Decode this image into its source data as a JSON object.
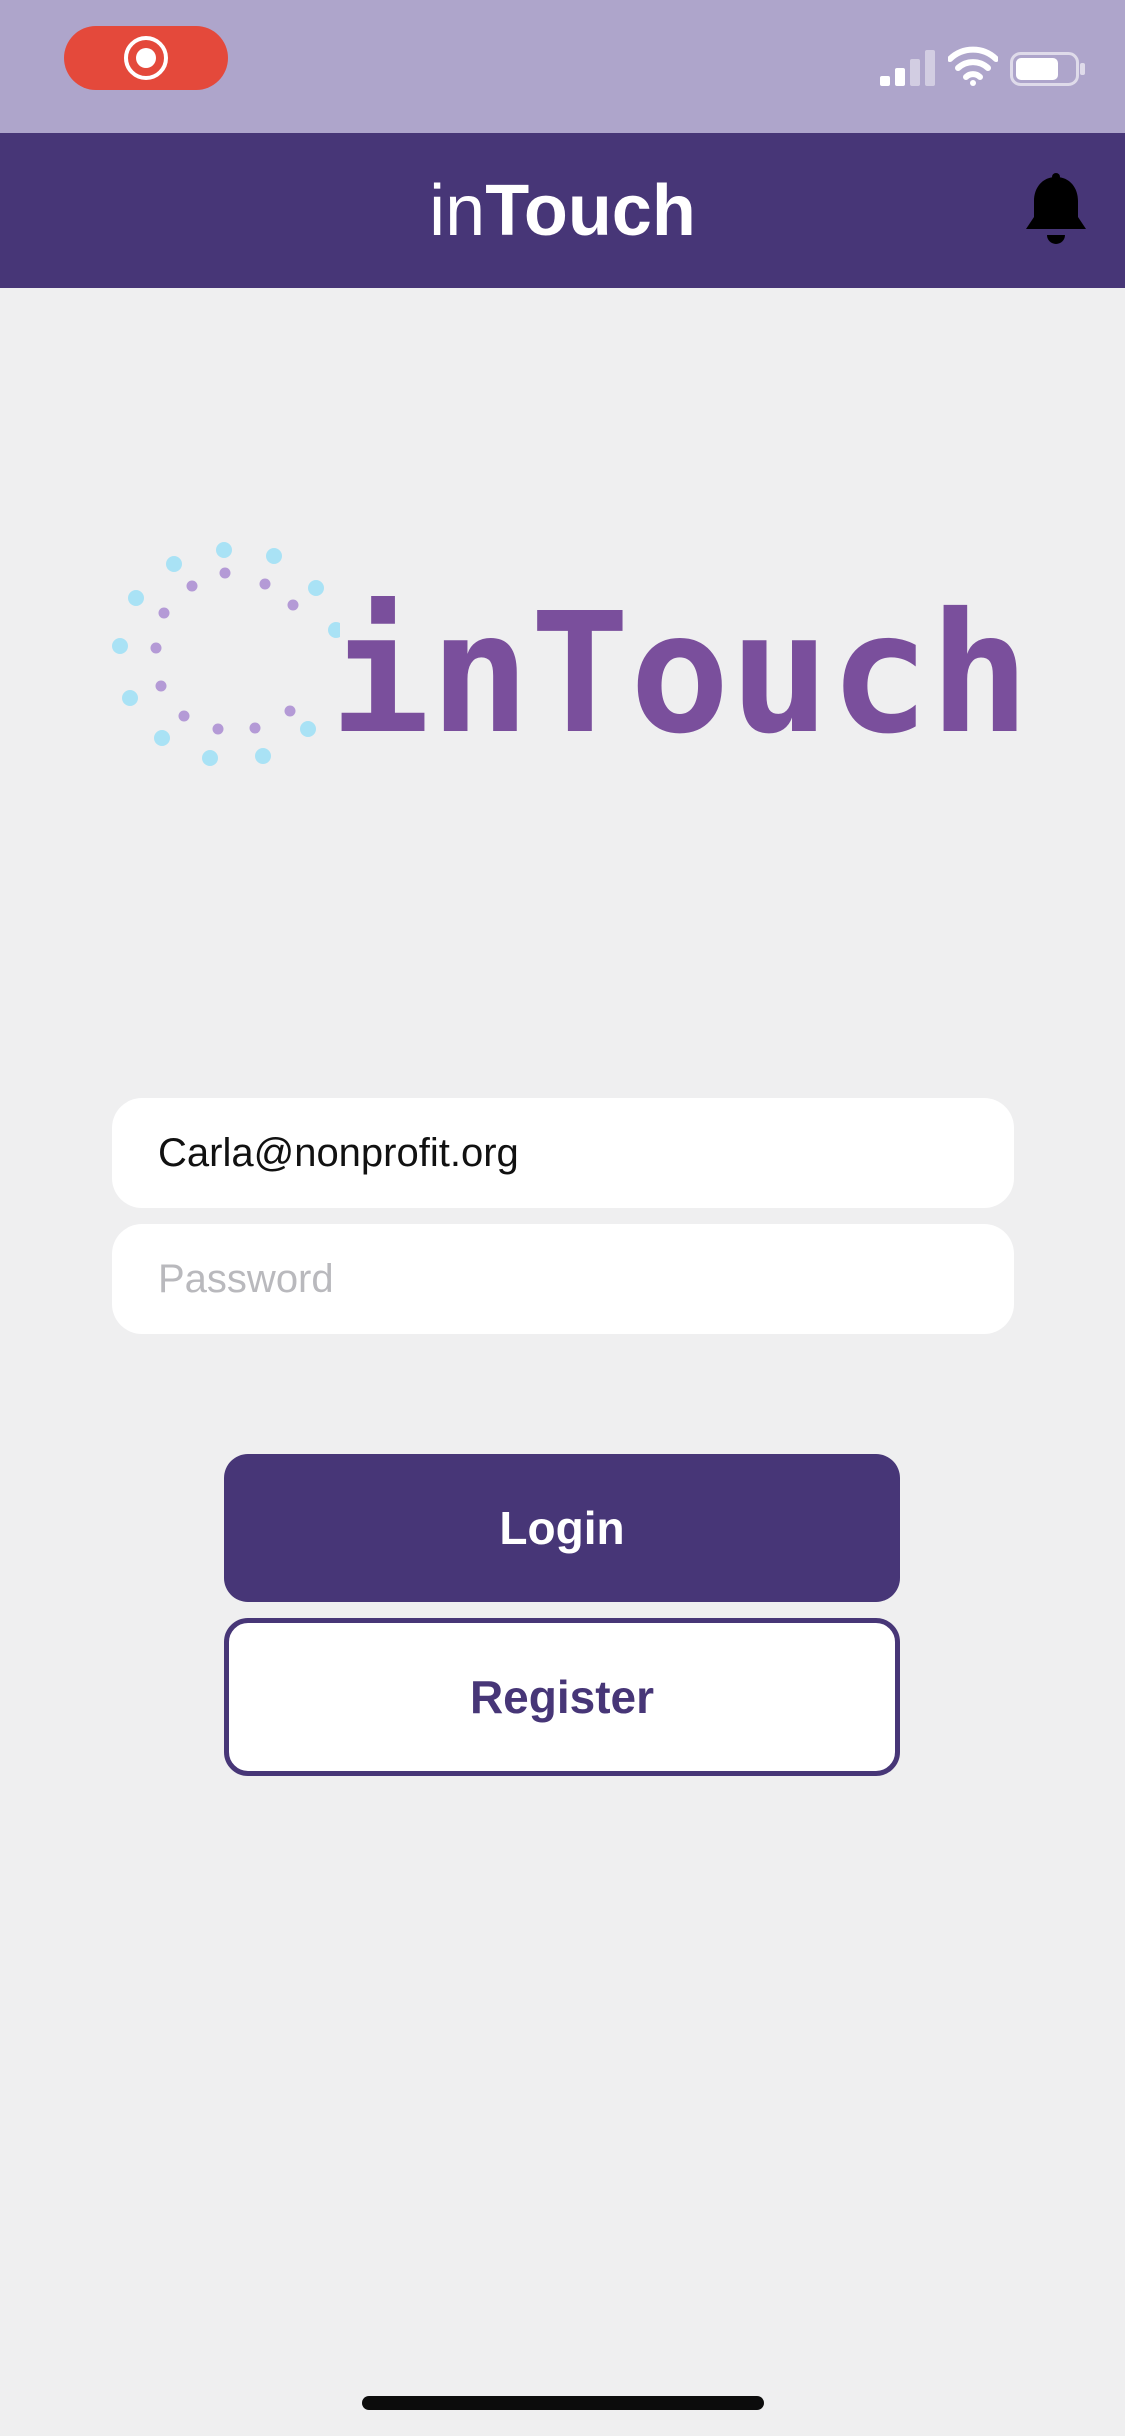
{
  "status_bar": {
    "recording_icon": "screen-recording-icon",
    "signal_icon": "cellular-signal-icon",
    "wifi_icon": "wifi-icon",
    "battery_icon": "battery-icon",
    "battery_level": 0.7
  },
  "header": {
    "title_light": "in",
    "title_bold": "Touch",
    "notification_icon": "bell-icon"
  },
  "logo": {
    "text": "inTouch",
    "mark_icon": "dotted-circle-logo-icon"
  },
  "form": {
    "email_value": "Carla@nonprofit.org",
    "password_placeholder": "Password",
    "login_label": "Login",
    "register_label": "Register"
  },
  "colors": {
    "header": "#473677",
    "status_bar": "#aea5cb",
    "background": "#efeff0",
    "logo_text": "#7a4f9c",
    "logo_dots_light": "#a9e2f5",
    "logo_dots_purple": "#b49ad6",
    "recording": "#e4493b"
  }
}
